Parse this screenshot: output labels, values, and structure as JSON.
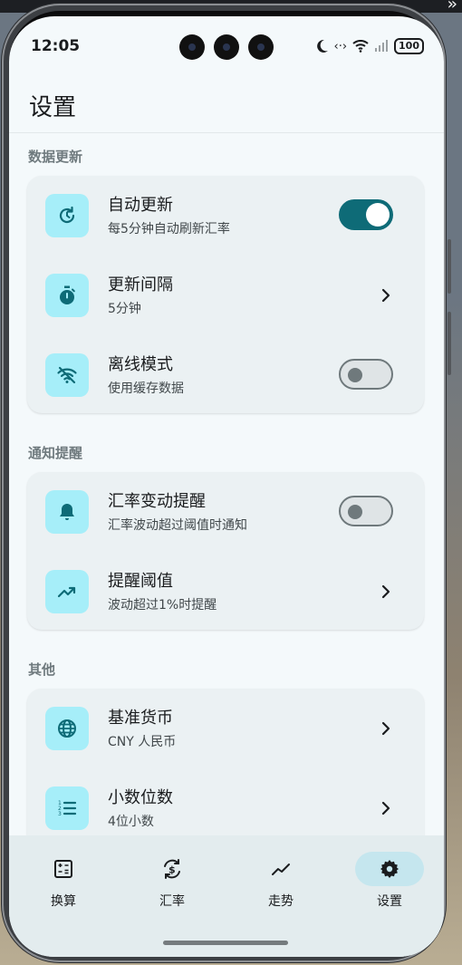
{
  "status": {
    "time": "12:05",
    "battery": "100"
  },
  "header": {
    "title": "设置"
  },
  "sections": [
    {
      "label": "数据更新",
      "rows": [
        {
          "title": "自动更新",
          "subtitle": "每5分钟自动刷新汇率",
          "icon": "refresh-clock-icon",
          "control": "toggle",
          "on": true
        },
        {
          "title": "更新间隔",
          "subtitle": "5分钟",
          "icon": "timer-icon",
          "control": "chevron"
        },
        {
          "title": "离线模式",
          "subtitle": "使用缓存数据",
          "icon": "wifi-off-icon",
          "control": "toggle",
          "on": false
        }
      ]
    },
    {
      "label": "通知提醒",
      "rows": [
        {
          "title": "汇率变动提醒",
          "subtitle": "汇率波动超过阈值时通知",
          "icon": "bell-icon",
          "control": "toggle",
          "on": false
        },
        {
          "title": "提醒阈值",
          "subtitle": "波动超过1%时提醒",
          "icon": "trending-up-icon",
          "control": "chevron"
        }
      ]
    },
    {
      "label": "其他",
      "rows": [
        {
          "title": "基准货币",
          "subtitle": "CNY 人民币",
          "icon": "globe-icon",
          "control": "chevron"
        },
        {
          "title": "小数位数",
          "subtitle": "4位小数",
          "icon": "numbered-list-icon",
          "control": "chevron"
        }
      ]
    }
  ],
  "nav": {
    "items": [
      {
        "label": "换算",
        "icon": "calculator-icon",
        "active": false
      },
      {
        "label": "汇率",
        "icon": "currency-exchange-icon",
        "active": false
      },
      {
        "label": "走势",
        "icon": "trend-line-icon",
        "active": false
      },
      {
        "label": "设置",
        "icon": "gear-icon",
        "active": true
      }
    ]
  },
  "colors": {
    "accent": "#0e6b77",
    "icon_bg": "#a6eef9",
    "card_bg": "#ebf1f3",
    "screen_bg": "#f4f9fb"
  }
}
